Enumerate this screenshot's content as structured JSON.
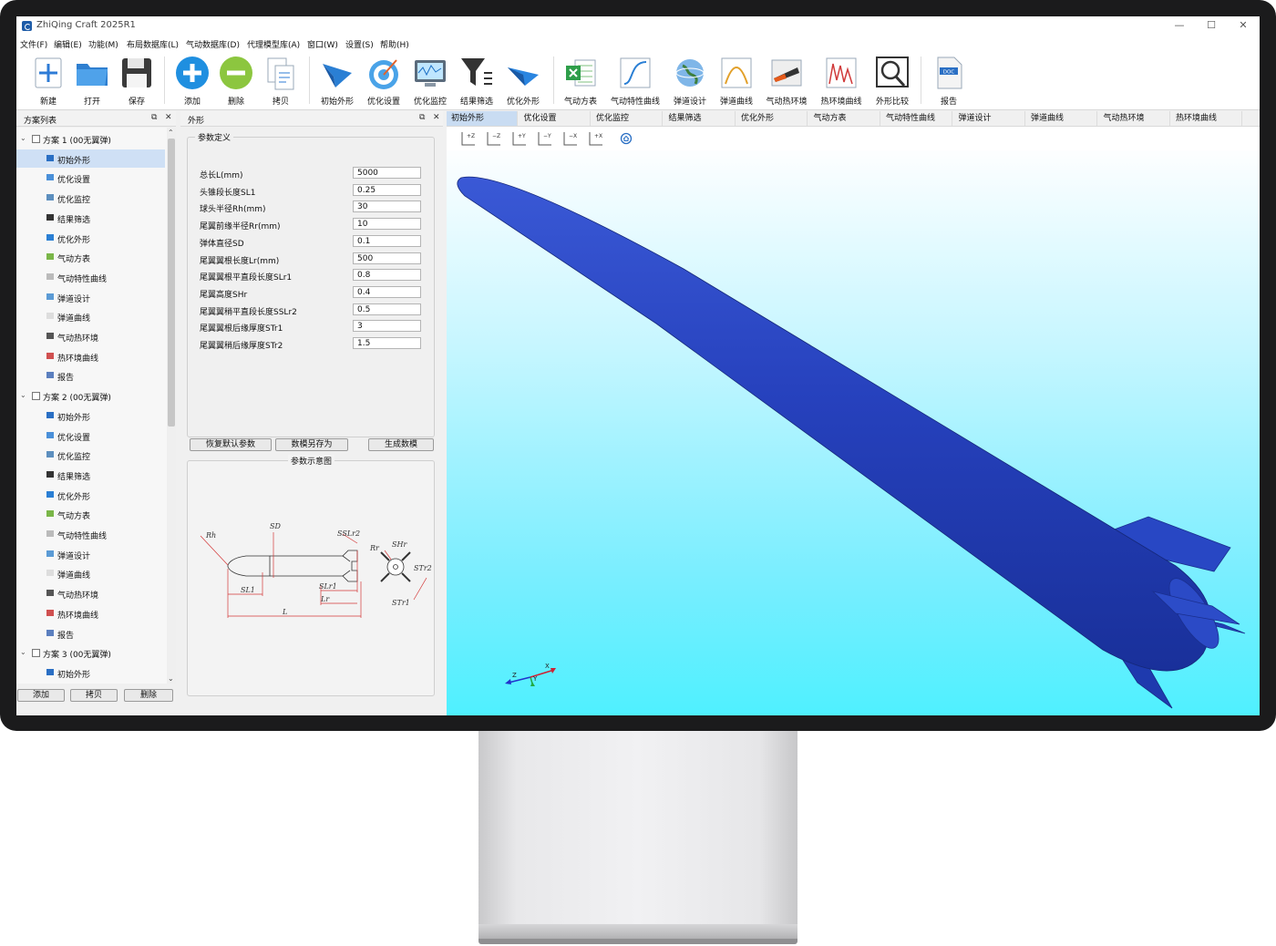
{
  "window": {
    "title": "ZhiQing Craft 2025R1",
    "controls": [
      "—",
      "☐",
      "✕"
    ]
  },
  "menu": [
    "文件(F)",
    "编辑(E)",
    "功能(M)",
    "布局数据库(L)",
    "气动数据库(D)",
    "代理模型库(A)",
    "窗口(W)",
    "设置(S)",
    "帮助(H)"
  ],
  "toolbar": [
    {
      "label": "新建",
      "icon": "new-icon"
    },
    {
      "label": "打开",
      "icon": "open-folder-icon"
    },
    {
      "label": "保存",
      "icon": "save-disk-icon"
    },
    {
      "label": "添加",
      "icon": "add-circle-icon"
    },
    {
      "label": "删除",
      "icon": "remove-circle-icon"
    },
    {
      "label": "拷贝",
      "icon": "copy-icon"
    },
    {
      "label": "初始外形",
      "icon": "initial-shape-icon"
    },
    {
      "label": "优化设置",
      "icon": "optimization-target-icon"
    },
    {
      "label": "优化监控",
      "icon": "monitor-icon"
    },
    {
      "label": "结果筛选",
      "icon": "filter-icon"
    },
    {
      "label": "优化外形",
      "icon": "optimized-shape-icon"
    },
    {
      "label": "气动方表",
      "icon": "excel-table-icon"
    },
    {
      "label": "气动特性曲线",
      "icon": "aero-curve-icon"
    },
    {
      "label": "弹道设计",
      "icon": "globe-icon"
    },
    {
      "label": "弹道曲线",
      "icon": "trajectory-curve-icon"
    },
    {
      "label": "气动热环境",
      "icon": "heat-environment-icon"
    },
    {
      "label": "热环境曲线",
      "icon": "heat-curve-icon"
    },
    {
      "label": "外形比较",
      "icon": "shape-compare-icon"
    },
    {
      "label": "报告",
      "icon": "doc-report-icon"
    }
  ],
  "scheme_panel": {
    "title": "方案列表",
    "buttons": [
      "添加",
      "拷贝",
      "删除"
    ],
    "rows": [
      {
        "type": "scheme",
        "label": "方案 1 (00无翼弹)"
      },
      {
        "type": "item",
        "label": "初始外形",
        "selected": true
      },
      {
        "type": "item",
        "label": "优化设置"
      },
      {
        "type": "item",
        "label": "优化监控"
      },
      {
        "type": "item",
        "label": "结果筛选"
      },
      {
        "type": "item",
        "label": "优化外形"
      },
      {
        "type": "item",
        "label": "气动方表"
      },
      {
        "type": "item",
        "label": "气动特性曲线"
      },
      {
        "type": "item",
        "label": "弹道设计"
      },
      {
        "type": "item",
        "label": "弹道曲线"
      },
      {
        "type": "item",
        "label": "气动热环境"
      },
      {
        "type": "item",
        "label": "热环境曲线"
      },
      {
        "type": "item",
        "label": "报告"
      },
      {
        "type": "scheme",
        "label": "方案 2 (00无翼弹)"
      },
      {
        "type": "item",
        "label": "初始外形"
      },
      {
        "type": "item",
        "label": "优化设置"
      },
      {
        "type": "item",
        "label": "优化监控"
      },
      {
        "type": "item",
        "label": "结果筛选"
      },
      {
        "type": "item",
        "label": "优化外形"
      },
      {
        "type": "item",
        "label": "气动方表"
      },
      {
        "type": "item",
        "label": "气动特性曲线"
      },
      {
        "type": "item",
        "label": "弹道设计"
      },
      {
        "type": "item",
        "label": "弹道曲线"
      },
      {
        "type": "item",
        "label": "气动热环境"
      },
      {
        "type": "item",
        "label": "热环境曲线"
      },
      {
        "type": "item",
        "label": "报告"
      },
      {
        "type": "scheme",
        "label": "方案 3 (00无翼弹)"
      },
      {
        "type": "item",
        "label": "初始外形"
      }
    ]
  },
  "param_panel": {
    "title": "外形",
    "group_title": "参数定义",
    "params": [
      {
        "label": "总长L(mm)",
        "value": "5000"
      },
      {
        "label": "头锥段长度SL1",
        "value": "0.25"
      },
      {
        "label": "球头半径Rh(mm)",
        "value": "30"
      },
      {
        "label": "尾翼前缘半径Rr(mm)",
        "value": "10"
      },
      {
        "label": "弹体直径SD",
        "value": "0.1"
      },
      {
        "label": "尾翼翼根长度Lr(mm)",
        "value": "500"
      },
      {
        "label": "尾翼翼根平直段长度SLr1",
        "value": "0.8"
      },
      {
        "label": "尾翼高度SHr",
        "value": "0.4"
      },
      {
        "label": "尾翼翼稍平直段长度SSLr2",
        "value": "0.5"
      },
      {
        "label": "尾翼翼根后缘厚度STr1",
        "value": "3"
      },
      {
        "label": "尾翼翼稍后缘厚度STr2",
        "value": "1.5"
      }
    ],
    "buttons": [
      "恢复默认参数",
      "数模另存为",
      "生成数模"
    ],
    "diagram_title": "参数示意图",
    "diagram_labels": {
      "rh": "Rh",
      "sd": "SD",
      "sslr2": "SSLr2",
      "slr1": "SLr1",
      "lr": "Lr",
      "sl1": "SL1",
      "l": "L",
      "rr": "Rr",
      "shr": "SHr",
      "str2": "STr2",
      "str1": "STr1"
    }
  },
  "view": {
    "tabs": [
      "初始外形",
      "优化设置",
      "优化监控",
      "结果筛选",
      "优化外形",
      "气动方表",
      "气动特性曲线",
      "弹道设计",
      "弹道曲线",
      "气动热环境",
      "热环境曲线"
    ],
    "active_tab": 0,
    "view_buttons": [
      "+Z",
      "−Z",
      "+Y",
      "−Y",
      "−X",
      "+X"
    ],
    "axes": {
      "x": "X",
      "y": "Y",
      "z": "Z"
    },
    "colors": {
      "missile": "#2340b8",
      "background_top": "#fdfeff",
      "background_bottom": "#4ff0ff"
    }
  }
}
